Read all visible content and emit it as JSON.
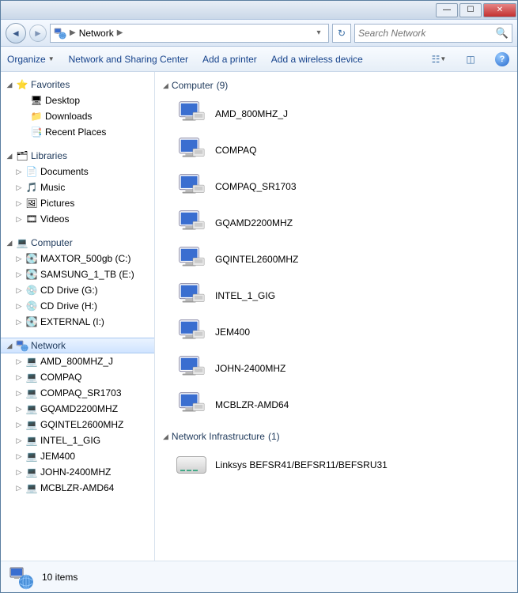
{
  "breadcrumb": {
    "location": "Network"
  },
  "search": {
    "placeholder": "Search Network"
  },
  "toolbar": {
    "organize": "Organize",
    "sharing": "Network and Sharing Center",
    "addPrinter": "Add a printer",
    "addWireless": "Add a wireless device"
  },
  "sidebar": {
    "favorites": {
      "label": "Favorites",
      "items": [
        {
          "label": "Desktop",
          "icon": "desktop"
        },
        {
          "label": "Downloads",
          "icon": "folder"
        },
        {
          "label": "Recent Places",
          "icon": "recent"
        }
      ]
    },
    "libraries": {
      "label": "Libraries",
      "items": [
        {
          "label": "Documents",
          "icon": "doc"
        },
        {
          "label": "Music",
          "icon": "music"
        },
        {
          "label": "Pictures",
          "icon": "pic"
        },
        {
          "label": "Videos",
          "icon": "video"
        }
      ]
    },
    "computer": {
      "label": "Computer",
      "items": [
        {
          "label": "MAXTOR_500gb (C:)",
          "icon": "drive-win"
        },
        {
          "label": "SAMSUNG_1_TB (E:)",
          "icon": "drive"
        },
        {
          "label": "CD Drive (G:)",
          "icon": "cd"
        },
        {
          "label": "CD Drive (H:)",
          "icon": "cd"
        },
        {
          "label": "EXTERNAL (I:)",
          "icon": "drive"
        }
      ]
    },
    "network": {
      "label": "Network",
      "items": [
        {
          "label": "AMD_800MHZ_J"
        },
        {
          "label": "COMPAQ"
        },
        {
          "label": "COMPAQ_SR1703"
        },
        {
          "label": "GQAMD2200MHZ"
        },
        {
          "label": "GQINTEL2600MHZ"
        },
        {
          "label": "INTEL_1_GIG"
        },
        {
          "label": "JEM400"
        },
        {
          "label": "JOHN-2400MHZ"
        },
        {
          "label": "MCBLZR-AMD64"
        }
      ]
    }
  },
  "content": {
    "computers": {
      "header": "Computer",
      "count": "(9)",
      "items": [
        {
          "label": "AMD_800MHZ_J"
        },
        {
          "label": "COMPAQ"
        },
        {
          "label": "COMPAQ_SR1703"
        },
        {
          "label": "GQAMD2200MHZ"
        },
        {
          "label": "GQINTEL2600MHZ"
        },
        {
          "label": "INTEL_1_GIG"
        },
        {
          "label": "JEM400"
        },
        {
          "label": "JOHN-2400MHZ"
        },
        {
          "label": "MCBLZR-AMD64"
        }
      ]
    },
    "infra": {
      "header": "Network Infrastructure",
      "count": "(1)",
      "items": [
        {
          "label": "Linksys BEFSR41/BEFSR11/BEFSRU31"
        }
      ]
    }
  },
  "status": {
    "text": "10 items"
  }
}
